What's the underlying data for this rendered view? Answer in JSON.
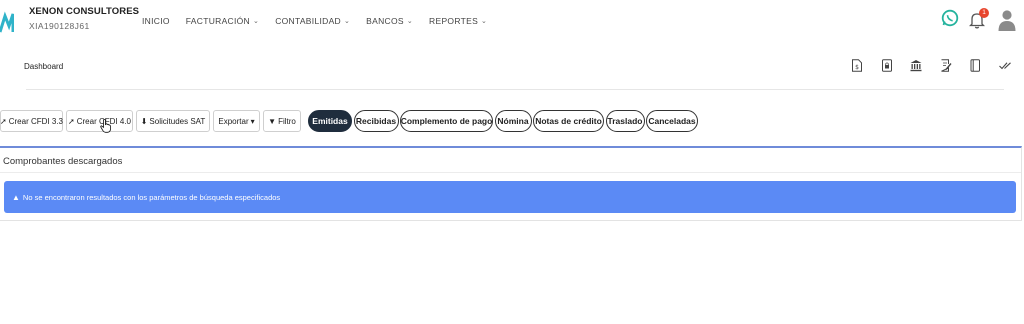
{
  "header": {
    "company_name": "XENON CONSULTORES",
    "company_rfc": "XIA190128J61",
    "nav": [
      {
        "label": "INICIO",
        "dropdown": false
      },
      {
        "label": "FACTURACIÓN",
        "dropdown": true
      },
      {
        "label": "CONTABILIDAD",
        "dropdown": true
      },
      {
        "label": "BANCOS",
        "dropdown": true
      },
      {
        "label": "REPORTES",
        "dropdown": true
      }
    ],
    "notification_count": "1",
    "icons": [
      "whatsapp-icon",
      "bell-icon",
      "user-avatar-icon"
    ]
  },
  "breadcrumb": {
    "label": "Dashboard"
  },
  "toolbar_icons": [
    "invoice-dollar-icon",
    "lock-icon",
    "bank-icon",
    "edit-document-icon",
    "book-icon",
    "double-check-icon"
  ],
  "actions": {
    "crear_cfdi_33": "Crear CFDI 3.3",
    "crear_cfdi_40": "Crear CFDI 4.0",
    "solicitudes_sat": "Solicitudes SAT",
    "exportar": "Exportar",
    "filtro": "Filtro"
  },
  "filter_tabs": [
    {
      "label": "Emitidas",
      "active": true
    },
    {
      "label": "Recibidas",
      "active": false
    },
    {
      "label": "Complemento de pago",
      "active": false
    },
    {
      "label": "Nómina",
      "active": false
    },
    {
      "label": "Notas de crédito",
      "active": false
    },
    {
      "label": "Traslado",
      "active": false
    },
    {
      "label": "Canceladas",
      "active": false
    }
  ],
  "panel": {
    "title": "Comprobantes descargados",
    "alert_text": "No se encontraron resultados con los parámetros de búsqueda especificados"
  },
  "colors": {
    "alert_bg": "#5b8af5",
    "active_tab_bg": "#1f2d3d",
    "card_border": "#6f8bd9",
    "whatsapp": "#25b39e",
    "badge": "#e8462e"
  }
}
